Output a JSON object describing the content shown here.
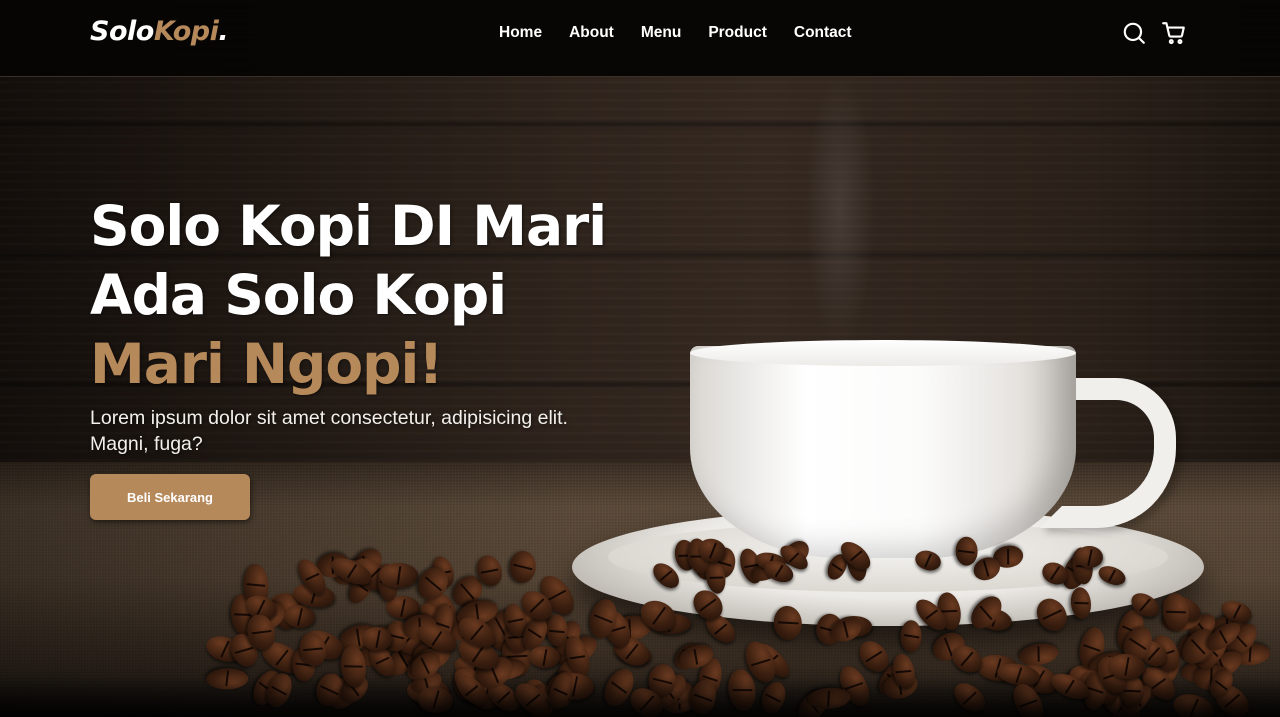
{
  "brand": {
    "logo_prefix": "Solo",
    "logo_accent": "Kopi",
    "logo_suffix": ".",
    "accent_color": "#b6895b"
  },
  "navbar": {
    "links": [
      {
        "label": "Home"
      },
      {
        "label": "About"
      },
      {
        "label": "Menu"
      },
      {
        "label": "Product"
      },
      {
        "label": "Contact"
      }
    ],
    "icons": [
      "search-icon",
      "shopping-cart-icon"
    ]
  },
  "hero": {
    "title_line_1": "Solo Kopi DI Mari",
    "title_line_2": "Ada Solo Kopi",
    "title_highlight": "Mari Ngopi!",
    "description": "Lorem ipsum dolor sit amet consectetur, adipisicing elit. Magni, fuga?",
    "cta_label": "Beli Sekarang"
  }
}
